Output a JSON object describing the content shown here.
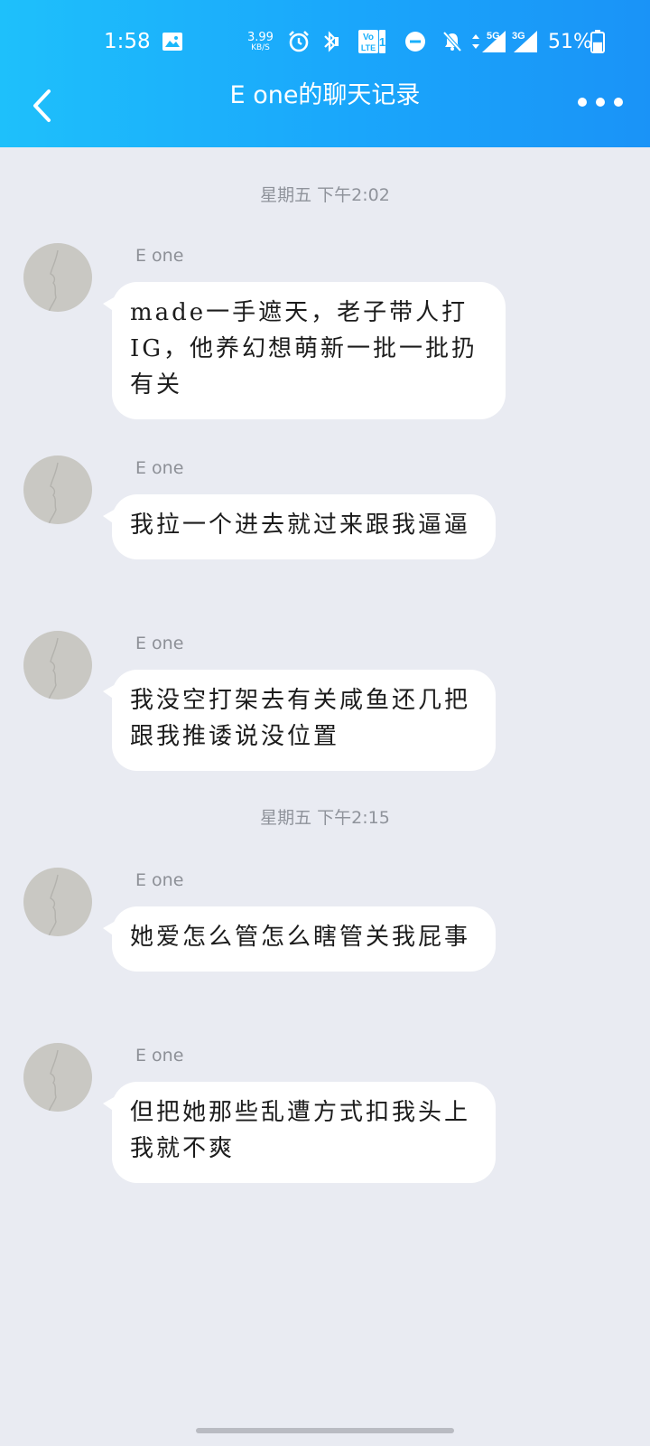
{
  "status_bar": {
    "time": "1:58",
    "net_speed_value": "3.99",
    "net_speed_unit": "KB/S",
    "volte_label_top": "Vo",
    "volte_label_bottom": "LTE",
    "volte_sim": "1",
    "signal1_label": "5G",
    "signal2_label": "3G",
    "battery_percent": "51%",
    "battery_level": 0.51
  },
  "header": {
    "title": "E one的聊天记录",
    "back_icon": "chevron-left-icon",
    "more_icon": "more-dots-icon"
  },
  "timestamps": [
    "星期五 下午2:02",
    "星期五 下午2:15"
  ],
  "messages": [
    {
      "sender": "E one",
      "text": "made一手遮天，老子带人打IG，他养幻想萌新一批一批扔有关"
    },
    {
      "sender": "E one",
      "text": "我拉一个进去就过来跟我逼逼"
    },
    {
      "sender": "E one",
      "text": "我没空打架去有关咸鱼还几把跟我推诿说没位置"
    },
    {
      "sender": "E one",
      "text": "她爱怎么管怎么瞎管关我屁事"
    },
    {
      "sender": "E one",
      "text": "但把她那些乱遭方式扣我头上我就不爽"
    }
  ],
  "colors": {
    "header_gradient_start": "#1ec0fb",
    "header_gradient_end": "#1a93f7",
    "chat_background": "#e9ebf2",
    "bubble": "#ffffff"
  }
}
